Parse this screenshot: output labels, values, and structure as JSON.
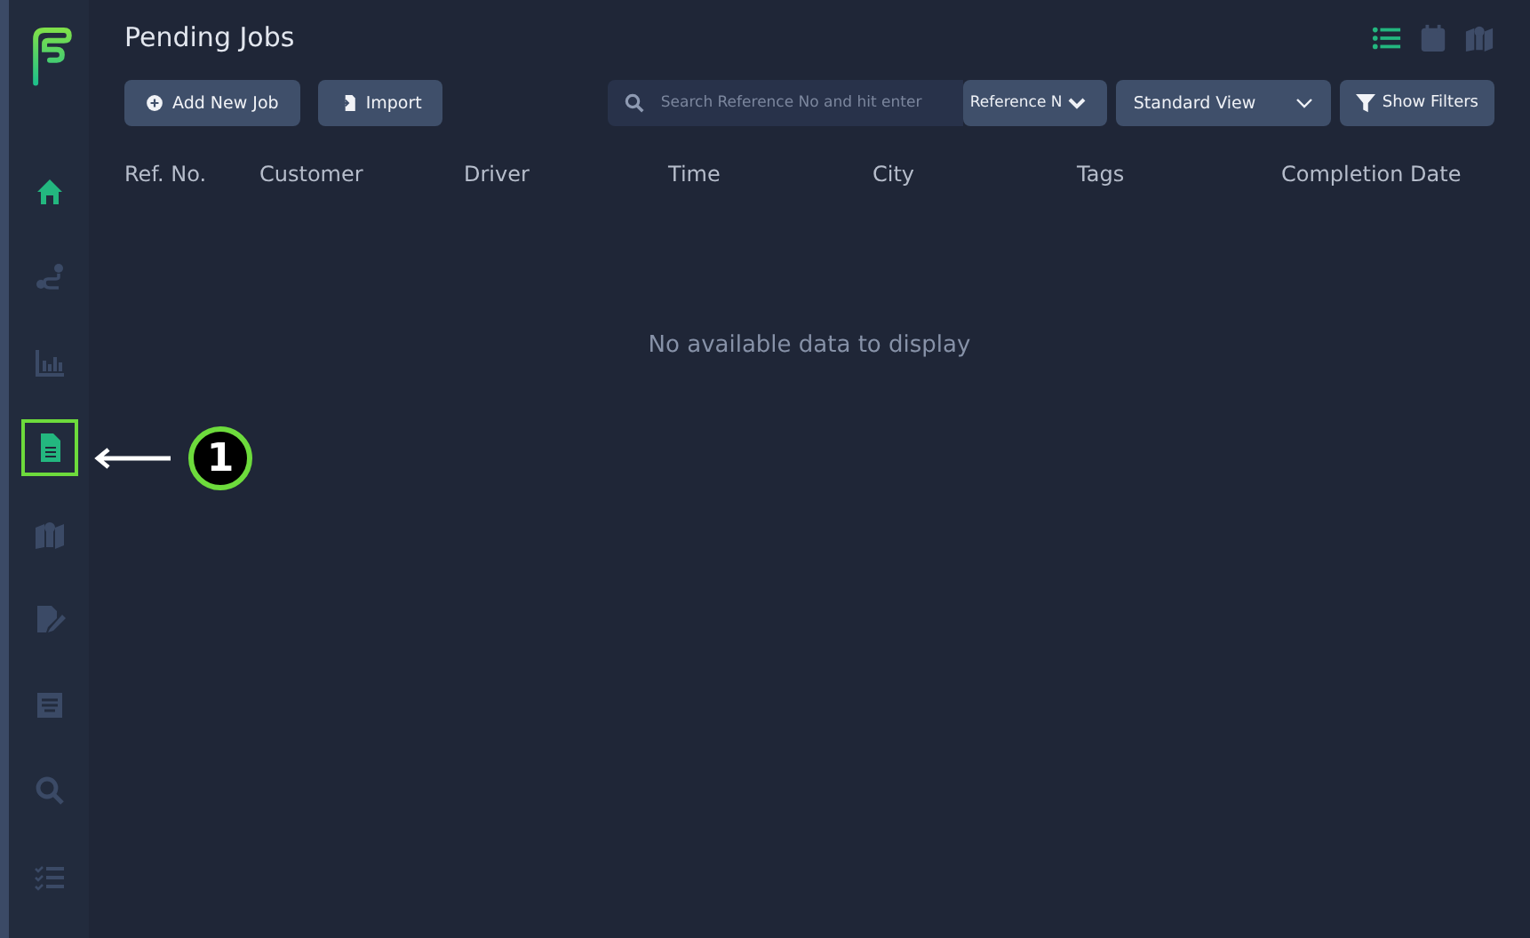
{
  "page_title": "Pending Jobs",
  "sidebar": {
    "items": [
      {
        "kind": "home",
        "selected": true
      },
      {
        "kind": "route",
        "selected": false
      },
      {
        "kind": "chart",
        "selected": false
      },
      {
        "kind": "document",
        "selected": true,
        "highlighted": true
      },
      {
        "kind": "map",
        "selected": false
      },
      {
        "kind": "signature",
        "selected": false
      },
      {
        "kind": "form",
        "selected": false
      },
      {
        "kind": "search",
        "selected": false
      },
      {
        "kind": "checklist",
        "selected": false
      }
    ]
  },
  "view_toggles": [
    {
      "kind": "list",
      "selected": true
    },
    {
      "kind": "calendar",
      "selected": false
    },
    {
      "kind": "map",
      "selected": false
    }
  ],
  "buttons": [
    {
      "kind": "add",
      "label": "Add New Job"
    },
    {
      "kind": "import",
      "label": "Import"
    }
  ],
  "search": {
    "placeholder": "Search Reference No and hit enter"
  },
  "search_field_select": {
    "value": "Reference N"
  },
  "view_select": {
    "value": "Standard View"
  },
  "filters_button": {
    "label": "Show Filters"
  },
  "table": {
    "columns": [
      "Ref. No.",
      "Customer",
      "Driver",
      "Time",
      "City",
      "Tags",
      "Completion Date"
    ],
    "empty_message": "No available data to display"
  },
  "annotation": {
    "number": "1"
  }
}
